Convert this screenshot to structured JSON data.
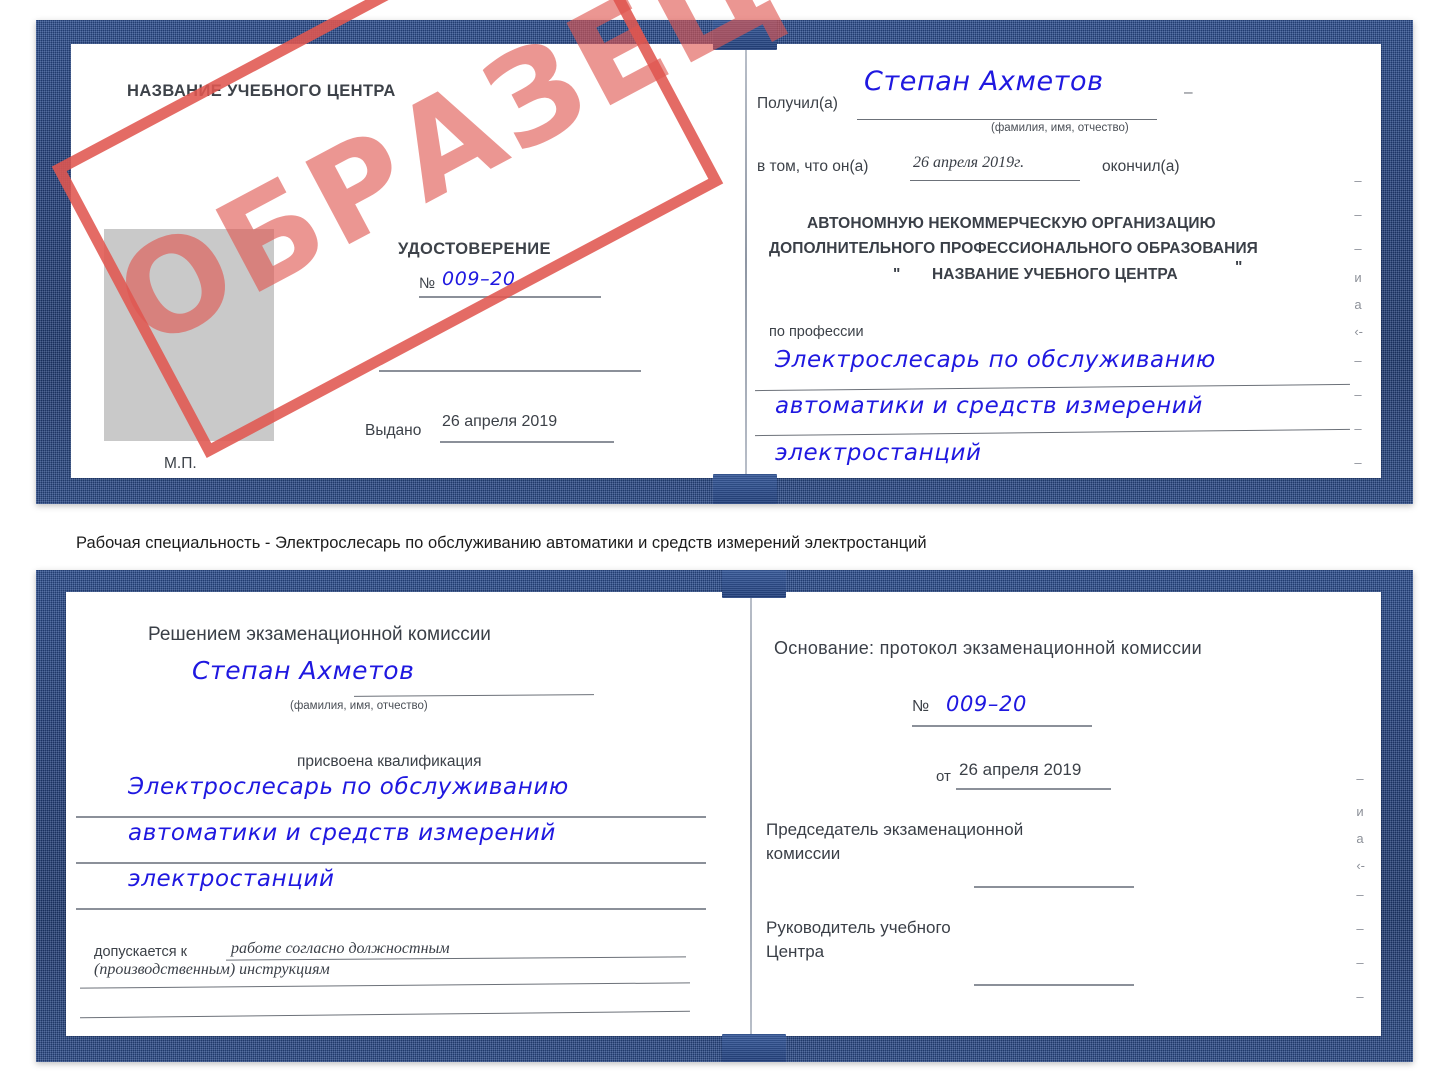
{
  "document": {
    "type": "certificate-scan",
    "colors": {
      "cover_blue": "#23417e",
      "stamp_red": "#e05650",
      "ink_blue": "#1f18e0",
      "rule_gray": "#8b9099",
      "photo_gray": "#c9c9c9"
    }
  },
  "stamp": {
    "text": "ОБРАЗЕЦ"
  },
  "caption": {
    "text": "Рабочая специальность - Электрослесарь по обслуживанию автоматики и средств измерений электростанций"
  },
  "top_certificate": {
    "left_page": {
      "center_name": "НАЗВАНИЕ УЧЕБНОГО ЦЕНТРА",
      "doc_title": "УДОСТОВЕРЕНИЕ",
      "number_label": "№",
      "number_value": "009–20",
      "issued_label": "Выдано",
      "issued_value": "26 апреля 2019",
      "seal_label": "М.П.",
      "photo_placeholder": "photo-box"
    },
    "right_page": {
      "received_label": "Получил(а)",
      "received_value": "Степан Ахметов",
      "fio_hint": "(фамилия, имя, отчество)",
      "in_that_label": "в том, что он(а)",
      "completion_date": "26 апреля 2019г.",
      "finished_label": "окончил(а)",
      "organization_line1": "АВТОНОМНУЮ НЕКОММЕРЧЕСКУЮ ОРГАНИЗАЦИЮ",
      "organization_line2": "ДОПОЛНИТЕЛЬНОГО ПРОФЕССИОНАЛЬНОГО ОБРАЗОВАНИЯ",
      "organization_quote_open": "\"",
      "organization_name": "НАЗВАНИЕ УЧЕБНОГО ЦЕНТРА",
      "organization_quote_close": "\"",
      "profession_label": "по профессии",
      "profession_line1": "Электрослесарь по обслуживанию",
      "profession_line2": "автоматики и средств измерений",
      "profession_line3": "электростанций",
      "margin_marks": [
        "–",
        "–",
        "–",
        "и",
        "а",
        "‹-",
        "–",
        "–",
        "–",
        "–"
      ]
    }
  },
  "bottom_certificate": {
    "left_page": {
      "commission_decision": "Решением экзаменационной комиссии",
      "name_value": "Степан Ахметов",
      "fio_hint": "(фамилия, имя, отчество)",
      "qualification_label": "присвоена квалификация",
      "qualification_line1": "Электрослесарь по обслуживанию",
      "qualification_line2": "автоматики и средств измерений",
      "qualification_line3": "электростанций",
      "admitted_label": "допускается к",
      "admitted_line1": "работе согласно должностным",
      "admitted_line2": "(производственным) инструкциям"
    },
    "right_page": {
      "basis_label": "Основание: протокол экзаменационной комиссии",
      "protocol_number_label": "№",
      "protocol_number_value": "009–20",
      "protocol_date_label": "от",
      "protocol_date_value": "26 апреля 2019",
      "chairman_line1": "Председатель экзаменационной",
      "chairman_line2": "комиссии",
      "head_line1": "Руководитель учебного",
      "head_line2": "Центра",
      "margin_marks": [
        "–",
        "и",
        "а",
        "‹-",
        "–",
        "–",
        "–",
        "–"
      ]
    }
  }
}
